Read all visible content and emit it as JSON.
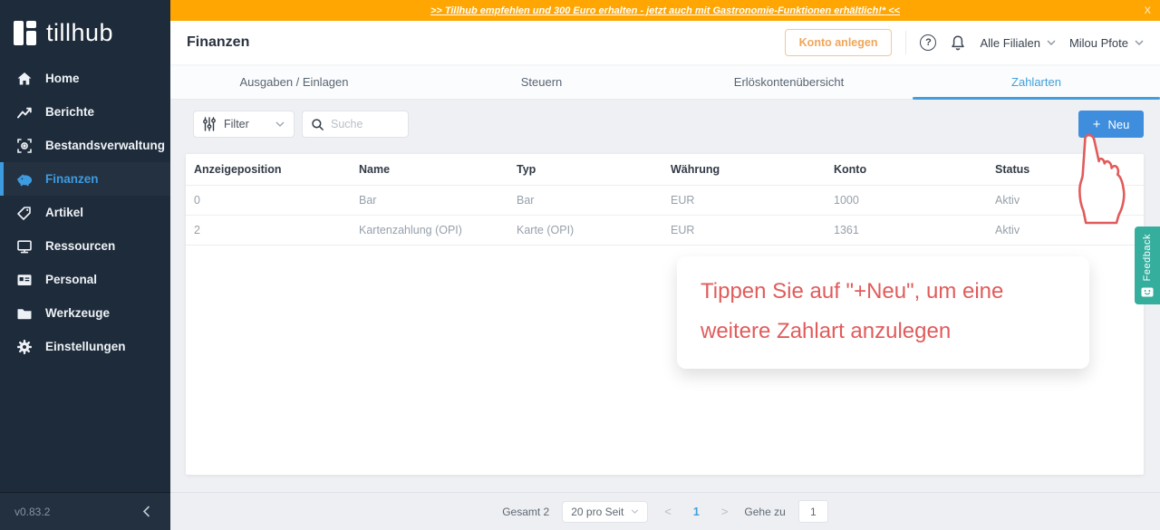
{
  "banner": {
    "text": ">> Tillhub empfehlen und 300 Euro erhalten - jetzt auch mit Gastronomie-Funktionen erhältlich!* <<",
    "close": "X"
  },
  "sidebar": {
    "logo_text": "tillhub",
    "items": [
      {
        "label": "Home",
        "icon": "home-icon",
        "active": false
      },
      {
        "label": "Berichte",
        "icon": "chart-icon",
        "active": false
      },
      {
        "label": "Bestandsverwaltung",
        "icon": "scan-icon",
        "active": false
      },
      {
        "label": "Finanzen",
        "icon": "piggy-bank-icon",
        "active": true
      },
      {
        "label": "Artikel",
        "icon": "tag-icon",
        "active": false
      },
      {
        "label": "Ressourcen",
        "icon": "monitor-icon",
        "active": false
      },
      {
        "label": "Personal",
        "icon": "id-badge-icon",
        "active": false
      },
      {
        "label": "Werkzeuge",
        "icon": "folder-icon",
        "active": false
      },
      {
        "label": "Einstellungen",
        "icon": "gear-icon",
        "active": false
      }
    ],
    "version": "v0.83.2"
  },
  "header": {
    "title": "Finanzen",
    "konto_button": "Konto anlegen",
    "help": "?",
    "branch_selector": "Alle Filialen",
    "user_menu": "Milou Pfote"
  },
  "tabs": [
    {
      "label": "Ausgaben / Einlagen",
      "active": false
    },
    {
      "label": "Steuern",
      "active": false
    },
    {
      "label": "Erlöskontenübersicht",
      "active": false
    },
    {
      "label": "Zahlarten",
      "active": true
    }
  ],
  "toolbar": {
    "filter_label": "Filter",
    "search_placeholder": "Suche",
    "plus": "+",
    "new_button_label": "Neu"
  },
  "table": {
    "columns": [
      "Anzeigeposition",
      "Name",
      "Typ",
      "Währung",
      "Konto",
      "Status"
    ],
    "rows": [
      [
        "0",
        "Bar",
        "Bar",
        "EUR",
        "1000",
        "Aktiv"
      ],
      [
        "2",
        "Kartenzahlung (OPI)",
        "Karte (OPI)",
        "EUR",
        "1361",
        "Aktiv"
      ]
    ]
  },
  "annotation": {
    "lines": [
      "Tippen Sie auf \"+Neu\", um eine",
      "weitere Zahlart anzulegen"
    ]
  },
  "feedback": {
    "label": "Feedback"
  },
  "pagination": {
    "total": "Gesamt 2",
    "page_size": "20 pro Seit",
    "prev": "<",
    "page": "1",
    "next": ">",
    "goto_label": "Gehe zu",
    "goto_value": "1"
  },
  "colors": {
    "banner_orange": "#ffa602",
    "primary_blue": "#3e8edd",
    "tab_blue": "#41a0dc",
    "sidebar_bg": "#1e2b3a",
    "active_blue": "#3d9be0",
    "feedback_teal": "#35ae9e",
    "annotation_red": "#e15b5b",
    "konto_orange": "#f0a65a"
  }
}
